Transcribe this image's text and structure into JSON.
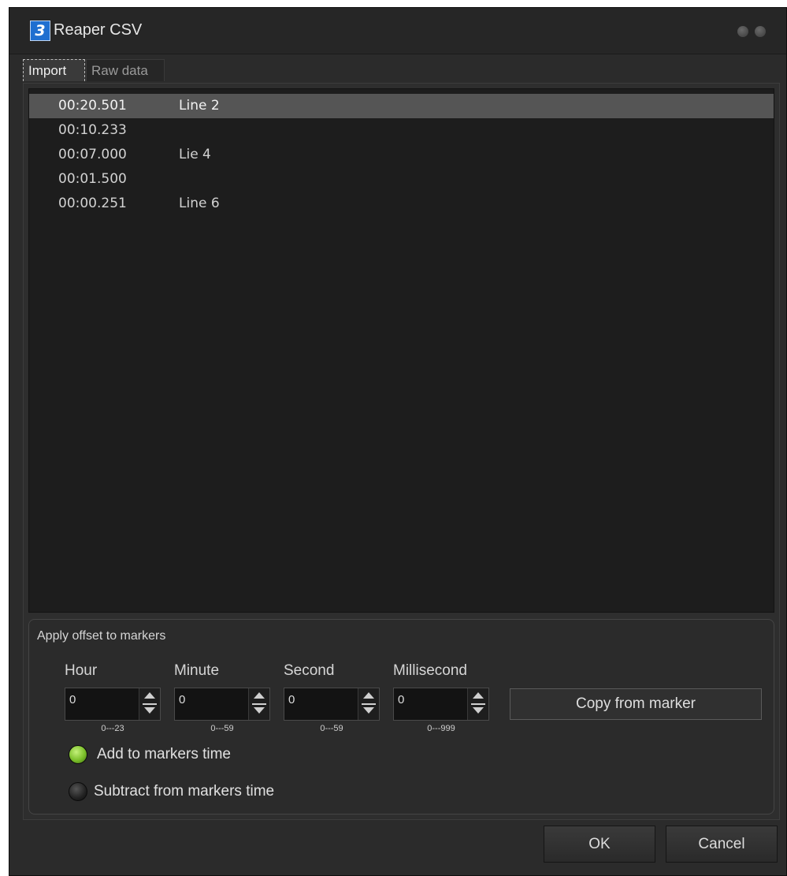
{
  "window": {
    "title": "Reaper CSV"
  },
  "tabs": [
    {
      "label": "Import",
      "active": true
    },
    {
      "label": "Raw data",
      "active": false
    }
  ],
  "markers": [
    {
      "time": "00:20.501",
      "name": "Line 2",
      "selected": true
    },
    {
      "time": "00:10.233",
      "name": ""
    },
    {
      "time": "00:07.000",
      "name": "Lie 4"
    },
    {
      "time": "00:01.500",
      "name": ""
    },
    {
      "time": "00:00.251",
      "name": "Line 6"
    }
  ],
  "offset": {
    "group_title": "Apply offset to markers",
    "fields": [
      {
        "label": "Hour",
        "value": "0",
        "range": "0---23"
      },
      {
        "label": "Minute",
        "value": "0",
        "range": "0---59"
      },
      {
        "label": "Second",
        "value": "0",
        "range": "0---59"
      },
      {
        "label": "Millisecond",
        "value": "0",
        "range": "0---999"
      }
    ],
    "copy_button": "Copy from marker",
    "add_label": "Add to markers time",
    "subtract_label": "Subtract from markers time",
    "selected_mode": "add"
  },
  "buttons": {
    "ok": "OK",
    "cancel": "Cancel"
  },
  "colors": {
    "radio_on": "#7bbf2a",
    "selection": "#555555",
    "app_icon": "#1f6fd0"
  }
}
